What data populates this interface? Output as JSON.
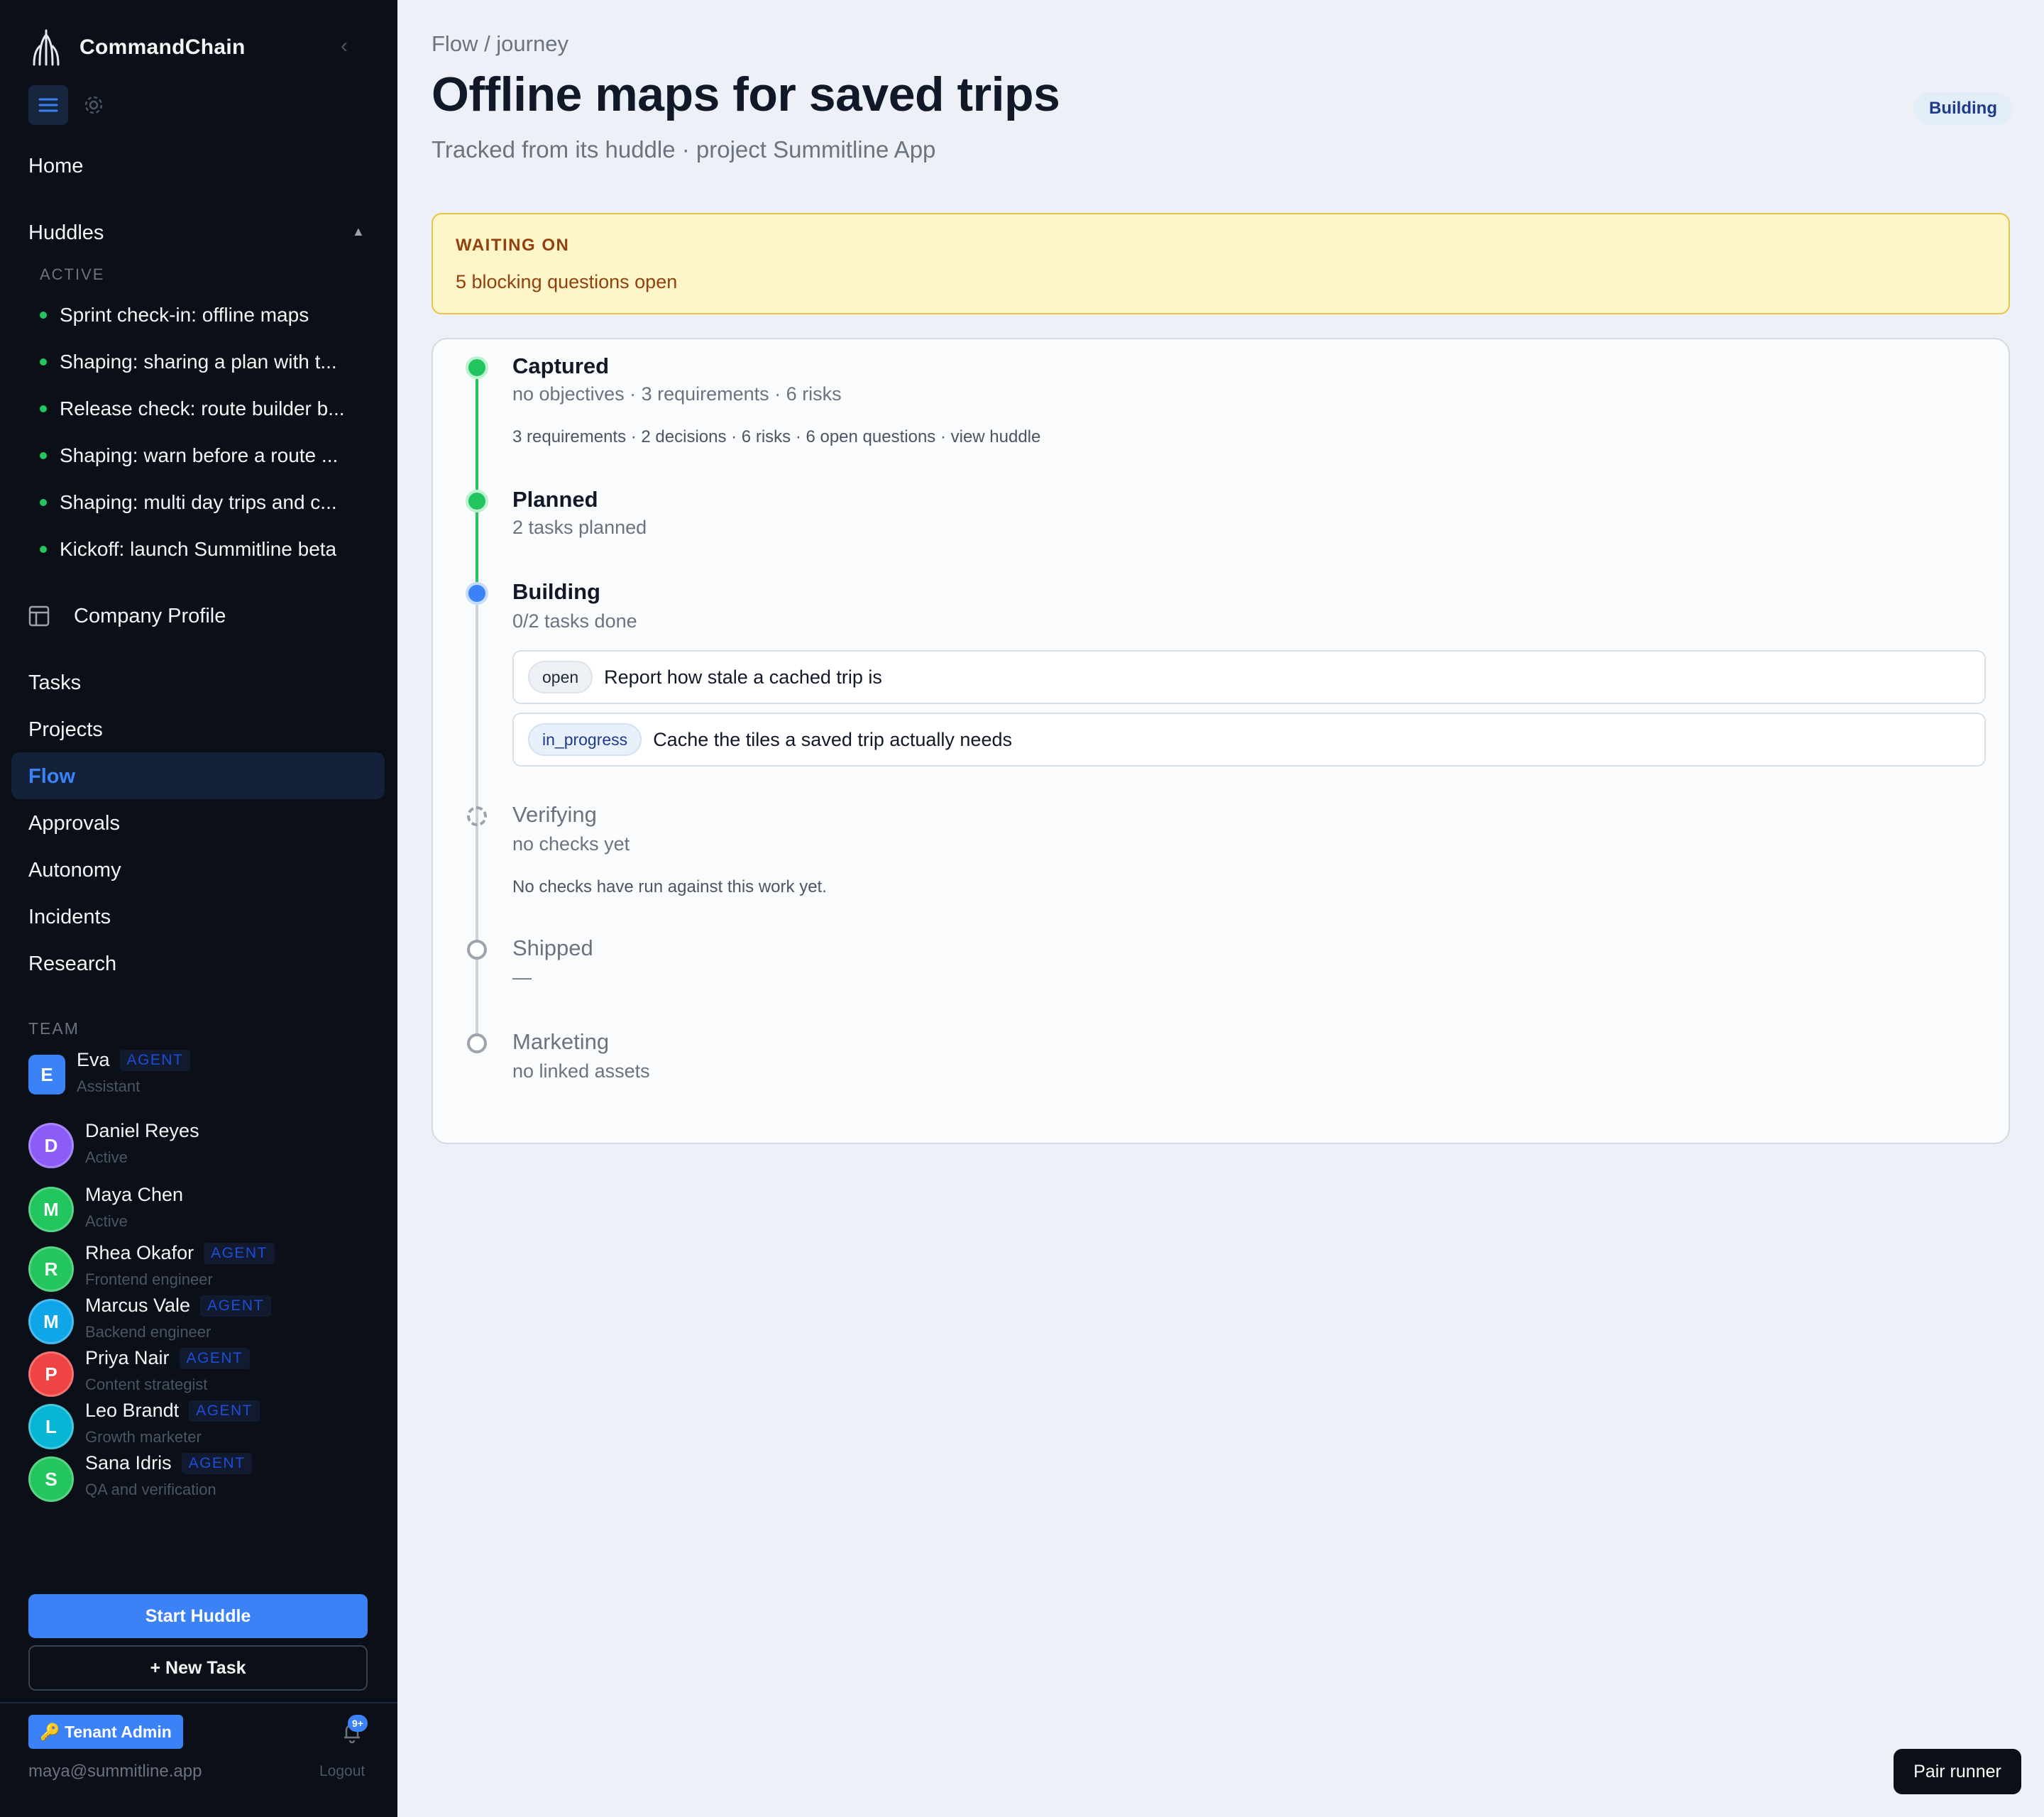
{
  "app": {
    "name": "CommandChain"
  },
  "sidebar": {
    "nav_home": "Home",
    "huddles_label": "Huddles",
    "huddles_active_label": "ACTIVE",
    "huddles": [
      "Sprint check-in: offline maps",
      "Shaping: sharing a plan with t...",
      "Release check: route builder b...",
      "Shaping: warn before a route ...",
      "Shaping: multi day trips and c...",
      "Kickoff: launch Summitline beta"
    ],
    "company_profile": "Company Profile",
    "nav": [
      "Tasks",
      "Projects",
      "Flow",
      "Approvals",
      "Autonomy",
      "Incidents",
      "Research"
    ],
    "active_nav": "Flow",
    "team_label": "TEAM",
    "team": [
      {
        "initial": "E",
        "name": "Eva",
        "agent": "AGENT",
        "role": "Assistant",
        "color": "#3b82f6"
      },
      {
        "initial": "D",
        "name": "Daniel Reyes",
        "agent": "",
        "role": "Active",
        "color": "#8b5cf6"
      },
      {
        "initial": "M",
        "name": "Maya Chen",
        "agent": "",
        "role": "Active",
        "color": "#22c55e"
      },
      {
        "initial": "R",
        "name": "Rhea Okafor",
        "agent": "AGENT",
        "role": "Frontend engineer",
        "color": "#22c55e"
      },
      {
        "initial": "M",
        "name": "Marcus Vale",
        "agent": "AGENT",
        "role": "Backend engineer",
        "color": "#0ea5e9"
      },
      {
        "initial": "P",
        "name": "Priya Nair",
        "agent": "AGENT",
        "role": "Content strategist",
        "color": "#ef4444"
      },
      {
        "initial": "L",
        "name": "Leo Brandt",
        "agent": "AGENT",
        "role": "Growth marketer",
        "color": "#06b6d4"
      },
      {
        "initial": "S",
        "name": "Sana Idris",
        "agent": "AGENT",
        "role": "QA and verification",
        "color": "#22c55e"
      }
    ],
    "start_huddle": "Start Huddle",
    "new_task": "+ New Task",
    "tenant_admin": "🔑 Tenant Admin",
    "notifications_badge": "9+",
    "user_email": "maya@summitline.app",
    "logout": "Logout"
  },
  "main": {
    "breadcrumb": "Flow / journey",
    "title": "Offline maps for saved trips",
    "subtitle": "Tracked from its huddle · project Summitline App",
    "status": "Building",
    "waiting": {
      "label": "WAITING ON",
      "text": "5 blocking questions open"
    },
    "stages": {
      "captured": {
        "title": "Captured",
        "sub": "no objectives · 3 requirements · 6 risks",
        "detail": "3 requirements · 2 decisions · 6 risks · 6 open questions · view huddle"
      },
      "planned": {
        "title": "Planned",
        "sub": "2 tasks planned"
      },
      "building": {
        "title": "Building",
        "sub": "0/2 tasks done",
        "tasks": [
          {
            "status": "open",
            "text": "Report how stale a cached trip is"
          },
          {
            "status": "in_progress",
            "text": "Cache the tiles a saved trip actually needs"
          }
        ]
      },
      "verifying": {
        "title": "Verifying",
        "sub": "no checks yet",
        "detail": "No checks have run against this work yet."
      },
      "shipped": {
        "title": "Shipped",
        "sub": "—"
      },
      "marketing": {
        "title": "Marketing",
        "sub": "no linked assets"
      }
    }
  },
  "pair_runner": "Pair runner"
}
